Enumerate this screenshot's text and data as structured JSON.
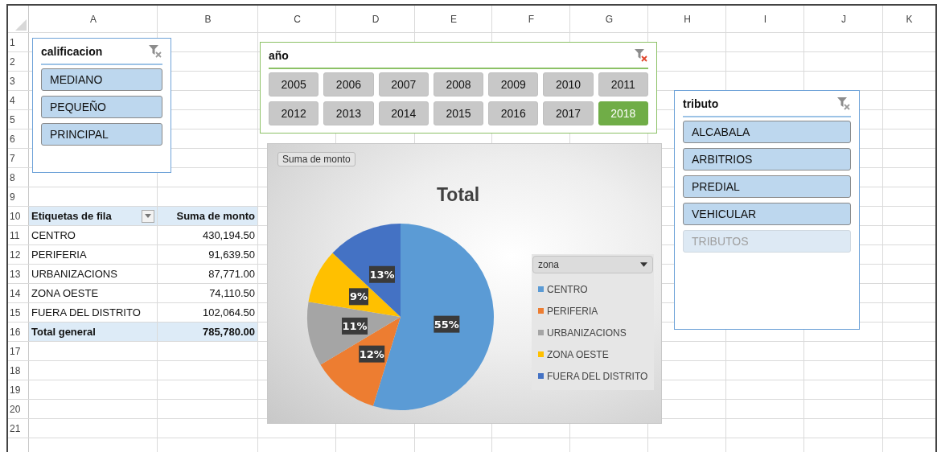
{
  "columns": [
    "A",
    "B",
    "C",
    "D",
    "E",
    "F",
    "G",
    "H",
    "I",
    "J",
    "K"
  ],
  "rows": [
    "1",
    "2",
    "3",
    "4",
    "5",
    "6",
    "7",
    "8",
    "9",
    "10",
    "11",
    "12",
    "13",
    "14",
    "15",
    "16",
    "17",
    "18",
    "19",
    "20",
    "21"
  ],
  "pivot_table": {
    "header": [
      "Etiquetas de fila",
      "Suma de monto"
    ],
    "rows": [
      {
        "label": "CENTRO",
        "value": "430,194.50"
      },
      {
        "label": "PERIFERIA",
        "value": "91,639.50"
      },
      {
        "label": "URBANIZACIONS",
        "value": "87,771.00"
      },
      {
        "label": "ZONA OESTE",
        "value": "74,110.50"
      },
      {
        "label": "FUERA DEL DISTRITO",
        "value": "102,064.50"
      }
    ],
    "total": {
      "label": "Total general",
      "value": "785,780.00"
    }
  },
  "slicers": [
    {
      "title": "calificacion",
      "kind": "blue",
      "filtered": false,
      "items": [
        {
          "label": "MEDIANO",
          "selected": true
        },
        {
          "label": "PEQUEÑO",
          "selected": true
        },
        {
          "label": "PRINCIPAL",
          "selected": true
        }
      ]
    },
    {
      "title": "año",
      "kind": "green",
      "filtered": true,
      "items": [
        {
          "label": "2005",
          "selected": false
        },
        {
          "label": "2006",
          "selected": false
        },
        {
          "label": "2007",
          "selected": false
        },
        {
          "label": "2008",
          "selected": false
        },
        {
          "label": "2009",
          "selected": false
        },
        {
          "label": "2010",
          "selected": false
        },
        {
          "label": "2011",
          "selected": false
        },
        {
          "label": "2012",
          "selected": false
        },
        {
          "label": "2013",
          "selected": false
        },
        {
          "label": "2014",
          "selected": false
        },
        {
          "label": "2015",
          "selected": false
        },
        {
          "label": "2016",
          "selected": false
        },
        {
          "label": "2017",
          "selected": false
        },
        {
          "label": "2018",
          "selected": true
        }
      ]
    },
    {
      "title": "tributo",
      "kind": "blue",
      "filtered": false,
      "items": [
        {
          "label": "ALCABALA",
          "selected": true
        },
        {
          "label": "ARBITRIOS",
          "selected": true
        },
        {
          "label": "PREDIAL",
          "selected": true
        },
        {
          "label": "VEHICULAR",
          "selected": true
        },
        {
          "label": "TRIBUTOS",
          "selected": false
        }
      ]
    }
  ],
  "chart": {
    "legend_field": "zona",
    "chart_data": {
      "type": "pie",
      "title": "Total",
      "categories": [
        "CENTRO",
        "PERIFERIA",
        "URBANIZACIONS",
        "ZONA OESTE",
        "FUERA DEL DISTRITO"
      ],
      "colors": [
        "#5b9bd5",
        "#ed7d31",
        "#a5a5a5",
        "#ffc000",
        "#4472c4"
      ],
      "series": [
        {
          "name": "Suma de monto",
          "values": [
            54.75,
            11.66,
            11.17,
            9.43,
            12.99
          ]
        }
      ],
      "value_labels": [
        "55%",
        "12%",
        "11%",
        "9%",
        "13%"
      ]
    }
  }
}
